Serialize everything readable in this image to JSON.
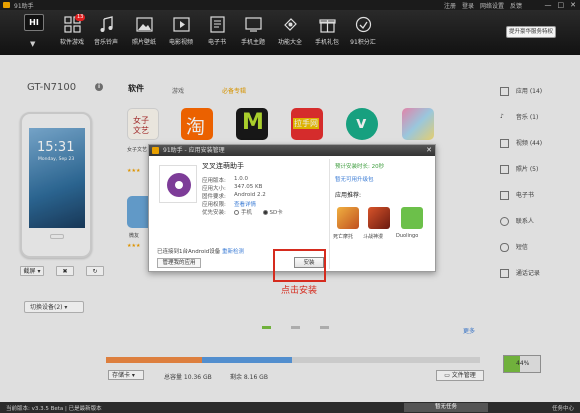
{
  "window": {
    "title": "91助手",
    "links": [
      "注册",
      "登录",
      "网络设置",
      "反馈"
    ],
    "controls": [
      "—",
      "□",
      "✕"
    ]
  },
  "nav": {
    "hi_label": "HI",
    "vip_label": "提升豪华服务特权",
    "items": [
      {
        "label": "软件游戏",
        "icon": "apps-grid-icon",
        "badge": "13"
      },
      {
        "label": "音乐铃声",
        "icon": "music-note-icon"
      },
      {
        "label": "照片壁纸",
        "icon": "photo-icon"
      },
      {
        "label": "电影视频",
        "icon": "film-icon"
      },
      {
        "label": "电子书",
        "icon": "book-icon"
      },
      {
        "label": "手机主题",
        "icon": "theme-icon"
      },
      {
        "label": "功能大全",
        "icon": "toolbox-icon"
      },
      {
        "label": "手机礼包",
        "icon": "gift-icon"
      },
      {
        "label": "91积分汇",
        "icon": "points-icon"
      }
    ]
  },
  "device": {
    "name": "GT-N7100",
    "clock": "15:31",
    "date": "Monday, Sep 23",
    "controls": [
      "截屏 ▾",
      "✖",
      "↻"
    ],
    "switch_label": "切换设备(2)  ▾"
  },
  "content": {
    "tabs": [
      "软件",
      "游戏",
      "必备专辑"
    ],
    "apps": [
      {
        "label": "女子文艺",
        "color": "#ffffff"
      },
      {
        "label": "淘宝",
        "color": "#ff6a00"
      },
      {
        "label": "M",
        "color": "#1a1a1a"
      },
      {
        "label": "拉手网",
        "color": "#e83030"
      },
      {
        "label": "Vine",
        "color": "#1aae8a"
      },
      {
        "label": "",
        "color": "#f2a6c4"
      }
    ],
    "row2_label": "微友",
    "more_link": "更多"
  },
  "storage": {
    "card_label": "存储卡 ▾",
    "total": "总容量  10.36 GB",
    "free": "剩余  8.16 GB",
    "file_button": "文件管理",
    "battery": "44%",
    "battery_level": 0.44
  },
  "sidebar": {
    "items": [
      {
        "label": "应用 (14)",
        "icon": "app-icon"
      },
      {
        "label": "音乐 (1)",
        "icon": "music-icon"
      },
      {
        "label": "视频 (44)",
        "icon": "video-icon"
      },
      {
        "label": "照片 (5)",
        "icon": "photo-icon"
      },
      {
        "label": "电子书",
        "icon": "ebook-icon"
      },
      {
        "label": "联系人",
        "icon": "contacts-icon"
      },
      {
        "label": "短信",
        "icon": "sms-icon"
      },
      {
        "label": "通话记录",
        "icon": "call-log-icon"
      }
    ]
  },
  "status": {
    "left": "当前版本: v3.3.5 Beta | 已是最新版本",
    "mid": "暂无任务",
    "right": "任务中心"
  },
  "dialog": {
    "title": "91助手 - 应用安装管理",
    "close": "✕",
    "app_name": "叉叉连萌助手",
    "info": [
      {
        "key": "应用版本:",
        "value": "1.0.0"
      },
      {
        "key": "应用大小:",
        "value": "347.05 KB"
      },
      {
        "key": "固件要求:",
        "value": "Android 2.2"
      },
      {
        "key": "应用权限:",
        "value": "查看详情"
      }
    ],
    "install_pref_label": "优先安装:",
    "install_options": [
      "手机",
      "SD卡"
    ],
    "connected": "已连接到1台Android设备",
    "connected_link": "重新检测",
    "manage_button": "管理我的应用",
    "install_button": "安装",
    "right_status": "预计安装时长:   20秒",
    "right_link": "暂无可用升级包",
    "rec_title": "应用推荐:",
    "recommendations": [
      {
        "label": "死亡摩托",
        "color": "#d97a2a"
      },
      {
        "label": "斗战神漫",
        "color": "#b33a22"
      },
      {
        "label": "Duolingo",
        "color": "#6cc04a"
      }
    ]
  },
  "annotation": {
    "caption": "点击安装"
  }
}
